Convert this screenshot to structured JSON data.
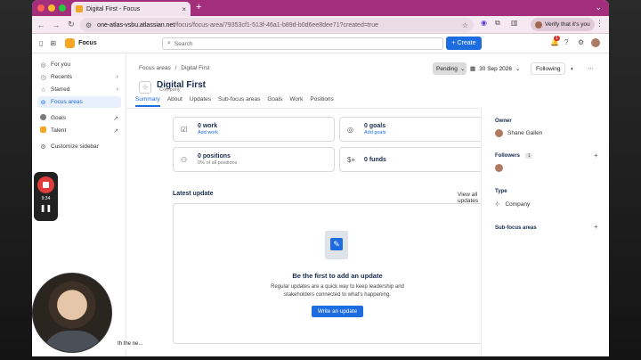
{
  "browser": {
    "tab_title": "Digital First - Focus",
    "new_tab": "+",
    "url_host": "one-atlas-vsbu.atlassian.net",
    "url_path": "/focus/focus-area/79353cf1-513f-46a1-b89d-b0d6ee8dee71?created=true",
    "verify_label": "Verify that it's you"
  },
  "appbar": {
    "app_name": "Focus",
    "search_placeholder": "Search",
    "create_label": "+ Create",
    "notification_count": "1"
  },
  "sidebar": {
    "items": [
      {
        "label": "For you",
        "icon": "user-circle-icon"
      },
      {
        "label": "Recents",
        "icon": "clock-icon"
      },
      {
        "label": "Starred",
        "icon": "star-icon"
      },
      {
        "label": "Focus areas",
        "icon": "focus-areas-icon"
      },
      {
        "label": "Goals",
        "icon": "goals-icon"
      },
      {
        "label": "Talent",
        "icon": "talent-icon"
      },
      {
        "label": "Customize sidebar",
        "icon": "customize-icon"
      }
    ]
  },
  "page": {
    "breadcrumb": [
      "Focus areas",
      "Digital First"
    ],
    "title": "Digital First",
    "subtitle": "Company",
    "status": "Pending",
    "date": "30 Sep 2026",
    "follow_label": "Following",
    "tabs": [
      "Summary",
      "About",
      "Updates",
      "Sub-focus areas",
      "Goals",
      "Work",
      "Positions"
    ],
    "cards": {
      "work": {
        "value": "0 work",
        "link": "Add work"
      },
      "goals": {
        "value": "0 goals",
        "link": "Add goals"
      },
      "positions": {
        "value": "0 positions",
        "note": "0% of all positions"
      },
      "funds": {
        "value": "0 funds"
      }
    },
    "latest_update": {
      "heading": "Latest update",
      "view_all": "View all updates",
      "empty_title": "Be the first to add an update",
      "empty_desc": "Regular updates are a quick way to keep leadership and stakeholders connected to what's happening.",
      "button": "Write an update"
    }
  },
  "right_panel": {
    "owner_label": "Owner",
    "owner_name": "Shane Gallen",
    "followers_label": "Followers",
    "followers_count": "1",
    "type_label": "Type",
    "type_value": "Company",
    "subfocus_label": "Sub-focus areas"
  },
  "overlays": {
    "rec_time": "9:34",
    "peek_text": "th the ne..."
  }
}
